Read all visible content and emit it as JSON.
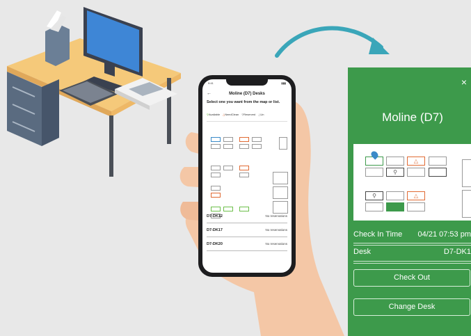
{
  "phone": {
    "status_time": "9:41",
    "header_title": "Moline (D7) Desks",
    "back_icon": "arrow-left-icon",
    "instruction": "Select one you want from the map or list.",
    "legend": [
      "Available",
      "NeedClean",
      "Reserved",
      "Un"
    ],
    "list": [
      {
        "id": "D7-DK12",
        "status": "No reservations"
      },
      {
        "id": "D7-DK17",
        "status": "No reservations"
      },
      {
        "id": "D7-DK20",
        "status": "No reservations"
      }
    ]
  },
  "panel": {
    "close_label": "×",
    "title": "Moline (D7)",
    "checkin_label": "Check In Time",
    "checkin_value": "04/21 07:53 pm",
    "desk_label": "Desk",
    "desk_value": "D7-DK1",
    "checkout_button": "Check Out",
    "change_button": "Change Desk"
  },
  "colors": {
    "panel_green": "#3d9a4b",
    "orange": "#e06a33",
    "available_green": "#6cbf4a",
    "arrow_teal": "#3aa6b9"
  }
}
